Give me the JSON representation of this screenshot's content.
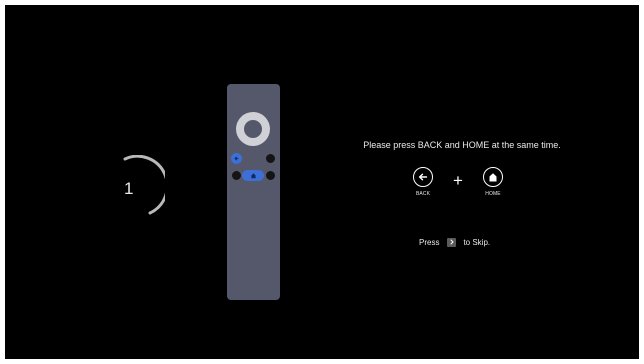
{
  "countdown": {
    "number": "1"
  },
  "remote": {
    "icons": [
      "dpad",
      "back-icon",
      "home-icon"
    ]
  },
  "instruction": {
    "text": "Please press BACK and HOME at the same time."
  },
  "keys": {
    "back_label": "BACK",
    "plus": "+",
    "home_label": "HOME"
  },
  "skip": {
    "before": "Press",
    "after": "to Skip."
  },
  "colors": {
    "background": "#000000",
    "remote_body": "#54586a",
    "remote_accent": "#3d6fd6",
    "text": "#e9e9e9"
  }
}
